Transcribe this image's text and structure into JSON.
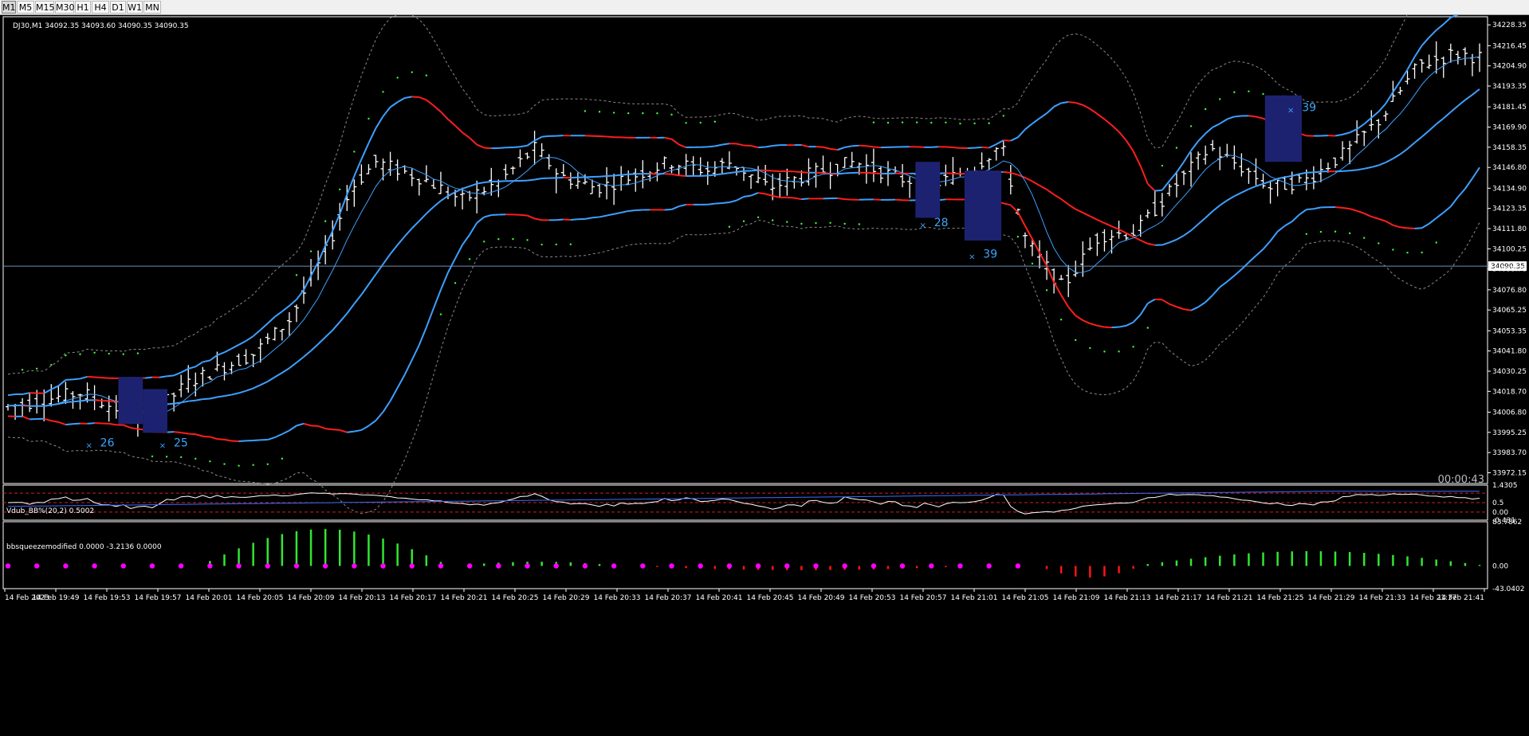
{
  "toolbar": {
    "timeframes": [
      {
        "label": "M1",
        "active": true
      },
      {
        "label": "M5",
        "active": false
      },
      {
        "label": "M15",
        "active": false
      },
      {
        "label": "M30",
        "active": false
      },
      {
        "label": "H1",
        "active": false
      },
      {
        "label": "H4",
        "active": false
      },
      {
        "label": "D1",
        "active": false
      },
      {
        "label": "W1",
        "active": false
      },
      {
        "label": "MN",
        "active": false
      }
    ]
  },
  "main_chart": {
    "header": "DJ30,M1  34092.35 34093.60 34090.35 34090.35",
    "current_price": 34090.35,
    "current_price_label": "34090.35",
    "timer": "00:00:43",
    "price_min": 33966,
    "price_max": 34233,
    "price_ticks": [
      "34228.35",
      "34216.45",
      "34204.90",
      "34193.35",
      "34181.45",
      "34169.90",
      "34158.35",
      "34146.80",
      "34134.90",
      "34123.35",
      "34111.80",
      "34100.25",
      "34088.70",
      "34076.80",
      "34065.25",
      "34053.35",
      "34041.80",
      "34030.25",
      "34018.70",
      "34006.80",
      "33995.25",
      "33983.70",
      "33972.15"
    ],
    "signal_labels": [
      "26",
      "25",
      "28",
      "39",
      "39"
    ]
  },
  "bb_percent_panel": {
    "header": "Vdub_BB%(20,2) 0.5002",
    "ticks": [
      "1.4305",
      "0.5",
      "0.00",
      "-0.431"
    ]
  },
  "squeeze_panel": {
    "header": "bbsqueezemodified 0.0000 -3.2136 0.0000",
    "ticks": [
      "83.7862",
      "0.00",
      "-43.0402"
    ]
  },
  "time_axis": {
    "labels": [
      "14 Feb 2023",
      "14 Feb 19:49",
      "14 Feb 19:53",
      "14 Feb 19:57",
      "14 Feb 20:01",
      "14 Feb 20:05",
      "14 Feb 20:09",
      "14 Feb 20:13",
      "14 Feb 20:17",
      "14 Feb 20:21",
      "14 Feb 20:25",
      "14 Feb 20:29",
      "14 Feb 20:33",
      "14 Feb 20:37",
      "14 Feb 20:41",
      "14 Feb 20:45",
      "14 Feb 20:49",
      "14 Feb 20:53",
      "14 Feb 20:57",
      "14 Feb 21:01",
      "14 Feb 21:05",
      "14 Feb 21:09",
      "14 Feb 21:13",
      "14 Feb 21:17",
      "14 Feb 21:21",
      "14 Feb 21:25",
      "14 Feb 21:29",
      "14 Feb 21:33",
      "14 Feb 21:37",
      "14 Feb 21:41"
    ]
  },
  "colors": {
    "background": "#000000",
    "axis": "#ffffff",
    "bars": "#ffffff",
    "red_band": "#ff1e1e",
    "blue_band": "#3ea0ff",
    "outer_band": "#8a8a8a",
    "psar": "#3dff3d",
    "signal_box": "#1d2270",
    "signal_text": "#3aa6ff",
    "osc_pos": "#32e632",
    "osc_neg": "#ff1414",
    "osc_dot": "#ff00ff",
    "bb_line": "#ffffff",
    "bb_signal": "#3c6cff",
    "guide": "#d02020"
  }
}
